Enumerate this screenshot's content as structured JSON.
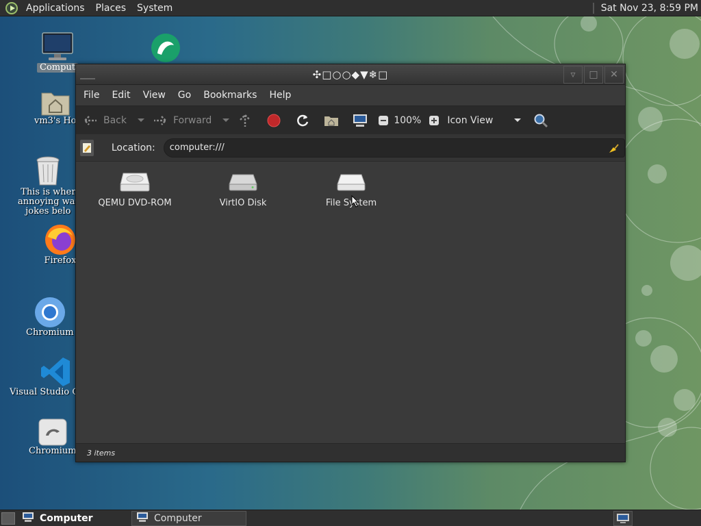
{
  "top_panel": {
    "menus": [
      "Applications",
      "Places",
      "System"
    ],
    "clock": "Sat Nov 23,  8:59 PM"
  },
  "desktop": {
    "icons": [
      {
        "label": "Comput",
        "selected": true
      },
      {
        "label": "vm3's Ho",
        "selected": false
      },
      {
        "label_lines": [
          "This is wher",
          "annoying wat",
          "jokes belo"
        ],
        "selected": false
      },
      {
        "label": "Firefox",
        "selected": false
      },
      {
        "label": "Chromium",
        "selected": false
      },
      {
        "label": "Visual Studio C",
        "selected": false
      },
      {
        "label": "Chromium",
        "selected": false
      }
    ]
  },
  "window": {
    "title": "✣□○○◆▼❄□",
    "menu": [
      "File",
      "Edit",
      "View",
      "Go",
      "Bookmarks",
      "Help"
    ],
    "toolbar": {
      "back": "Back",
      "forward": "Forward",
      "zoom": "100%",
      "view_mode": "Icon View"
    },
    "location": {
      "label": "Location:",
      "value": "computer:///"
    },
    "items": [
      {
        "label": "QEMU DVD-ROM"
      },
      {
        "label": "VirtIO Disk"
      },
      {
        "label": "File System"
      }
    ],
    "status": "3 items"
  },
  "bottom_panel": {
    "tasks": [
      {
        "label": "Computer",
        "active": true
      },
      {
        "label": "Computer",
        "active": false
      }
    ]
  },
  "colors": {
    "panel": "#2f2f2f",
    "window_bg": "#3a3a3a",
    "toolbar_bg": "#2a2a2a",
    "stop_red": "#c0282a"
  }
}
